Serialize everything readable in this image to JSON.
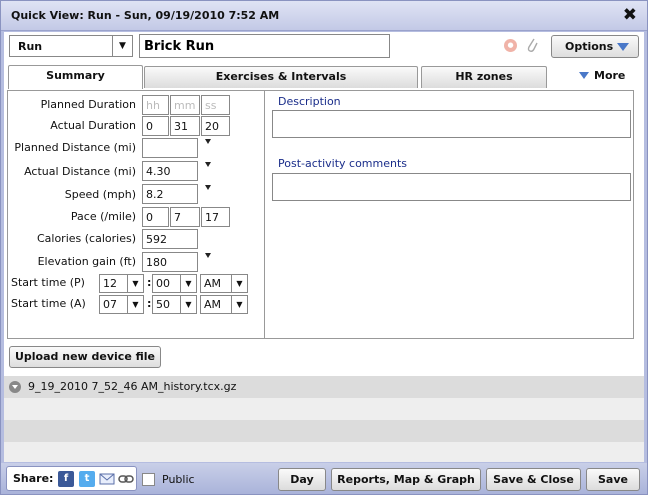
{
  "window": {
    "title": "Quick View: Run - Sun, 09/19/2010 7:52 AM",
    "close_glyph": "✖"
  },
  "header": {
    "sport_value": "Run",
    "workout_name": "Brick Run",
    "options_label": "Options"
  },
  "tabs": [
    {
      "label": "Summary",
      "active": true
    },
    {
      "label": "Exercises & Intervals",
      "active": false
    },
    {
      "label": "HR zones",
      "active": false
    }
  ],
  "more_label": "More",
  "fields": {
    "planned_duration": {
      "label": "Planned Duration",
      "hh": "hh",
      "mm": "mm",
      "ss": "ss"
    },
    "actual_duration": {
      "label": "Actual Duration",
      "h": "0",
      "m": "31",
      "s": "20"
    },
    "planned_distance": {
      "label": "Planned Distance (mi)",
      "value": ""
    },
    "actual_distance": {
      "label": "Actual Distance (mi)",
      "value": "4.30"
    },
    "speed": {
      "label": "Speed (mph)",
      "value": "8.2"
    },
    "pace": {
      "label": "Pace (/mile)",
      "h": "0",
      "m": "7",
      "s": "17"
    },
    "calories": {
      "label": "Calories (calories)",
      "value": "592"
    },
    "elevation": {
      "label": "Elevation gain (ft)",
      "value": "180"
    },
    "start_planned": {
      "label": "Start time (P)",
      "hour": "12",
      "minute": "00",
      "ampm": "AM"
    },
    "start_actual": {
      "label": "Start time (A)",
      "hour": "07",
      "minute": "50",
      "ampm": "AM"
    }
  },
  "description_label": "Description",
  "comments_label": "Post-activity comments",
  "upload_label": "Upload new device file",
  "files": [
    {
      "name": "9_19_2010 7_52_46 AM_history.tcx.gz"
    }
  ],
  "footer": {
    "share_label": "Share:",
    "share_icons": [
      "facebook-icon",
      "twitter-icon",
      "email-icon",
      "link-icon"
    ],
    "public_label": "Public",
    "buttons": [
      "Day",
      "Reports, Map & Graph",
      "Save & Close",
      "Save"
    ]
  },
  "colors": {
    "accent": "#4a78c8",
    "label_blue": "#1a2d8a",
    "facebook": "#3b5998",
    "twitter": "#55acee"
  }
}
